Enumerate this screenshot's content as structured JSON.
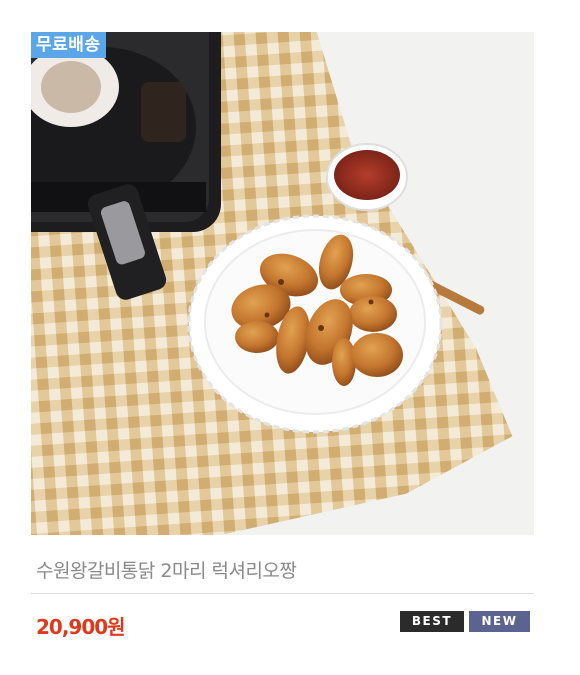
{
  "product": {
    "free_shipping_label": "무료배송",
    "name": "수원왕갈비통닭 2마리 럭셔리오짱",
    "price": "20,900원",
    "tags": [
      "BEST",
      "NEW"
    ],
    "image_description": "photo-air-fryer-chicken-plate"
  },
  "colors": {
    "price": "#e03a1e",
    "free_shipping_badge": "#5aa6e8",
    "best_tag": "#2b2b2b",
    "new_tag": "#5d6391"
  }
}
